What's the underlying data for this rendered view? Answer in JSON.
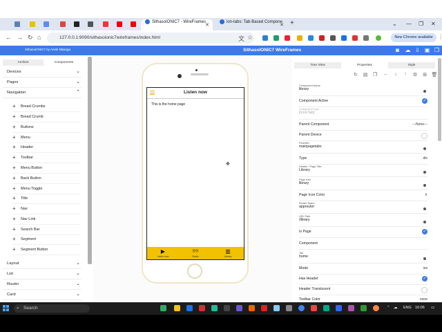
{
  "browser": {
    "tabs": [
      {
        "label": "SithasoIONIC7 - WireFrames",
        "active": true
      },
      {
        "label": "ion-tabs: Tab-Based Compone",
        "active": false
      }
    ],
    "small_tab_labels": [
      "FS",
      "JR"
    ],
    "new_tab": "+",
    "window_controls": [
      "⌄",
      "—",
      "❐",
      "✕"
    ],
    "url": "127.0.0.1:9090/sithasoionic7wireframes/index.html",
    "chrome_available": "New Chrome available"
  },
  "app": {
    "byline": "SithasoIONIC7 by Anele Mbanga",
    "title": "SithasoIONIC7 WireFrames"
  },
  "left_panel": {
    "tabs": [
      "Archive",
      "Components"
    ],
    "sections_top": [
      {
        "label": "Devices",
        "chev": "⌄"
      },
      {
        "label": "Pages",
        "chev": "⌄"
      },
      {
        "label": "Navigation",
        "chev": "⌃"
      }
    ],
    "navigation_items": [
      "Bread Crumbs",
      "Bread Crumb",
      "Buttons",
      "Menu",
      "Header",
      "Toolbar",
      "Menu Button",
      "Back Button",
      "Menu Toggle",
      "Title",
      "Nav",
      "Nav Link",
      "Search Bar",
      "Segment",
      "Segment Button"
    ],
    "sections_bottom": [
      {
        "label": "Layout",
        "chev": "⌄"
      },
      {
        "label": "List",
        "chev": "⌄"
      },
      {
        "label": "Router",
        "chev": "⌄"
      },
      {
        "label": "Card",
        "chev": "⌄"
      }
    ]
  },
  "phone": {
    "header_title": "Listen now",
    "content_text": "This is the home page",
    "tabs": [
      {
        "label": "Listen now",
        "icon": "▶"
      },
      {
        "label": "Radio",
        "icon": "((•))"
      },
      {
        "label": "Library",
        "icon": "▥"
      }
    ]
  },
  "right_panel": {
    "tabs": [
      "Tree View",
      "Properties",
      "Style"
    ],
    "properties": [
      {
        "kind": "field",
        "label": "Component Name",
        "value": "library"
      },
      {
        "kind": "check",
        "label": "Component Active"
      },
      {
        "kind": "field-muted",
        "label": "Component Type",
        "value": "[IonicTab]"
      },
      {
        "kind": "select",
        "label": "Parent Component",
        "value": "---None---"
      },
      {
        "kind": "radio",
        "label": "Parent Device"
      },
      {
        "kind": "field",
        "label": "ParentID",
        "value": "mainpagetabs"
      },
      {
        "kind": "select",
        "label": "Type",
        "value": "div"
      },
      {
        "kind": "field",
        "label": "Header / Page Title",
        "value": "Library"
      },
      {
        "kind": "field",
        "label": "Page Icon",
        "value": "library"
      },
      {
        "kind": "select",
        "label": "Page Icon Color",
        "value": ""
      },
      {
        "kind": "field",
        "label": "Router Name",
        "value": "approuter"
      },
      {
        "kind": "field",
        "label": "URL Path",
        "value": "/library"
      },
      {
        "kind": "check",
        "label": "Is Page"
      },
      {
        "kind": "plain",
        "label": "Component"
      },
      {
        "kind": "field",
        "label": "Tab",
        "value": "home"
      },
      {
        "kind": "select",
        "label": "Mode",
        "value": "ios"
      },
      {
        "kind": "check",
        "label": "Has Header"
      },
      {
        "kind": "radio",
        "label": "Header Translucent"
      },
      {
        "kind": "select",
        "label": "Toolbar Color",
        "value": "none"
      }
    ]
  },
  "taskbar": {
    "search": "Search",
    "lang": "ENG",
    "time": "16:06"
  },
  "colors": {
    "accent": "#3b7ae8",
    "tabbar": "#f2c200",
    "menu_icon": "#f5a623"
  }
}
